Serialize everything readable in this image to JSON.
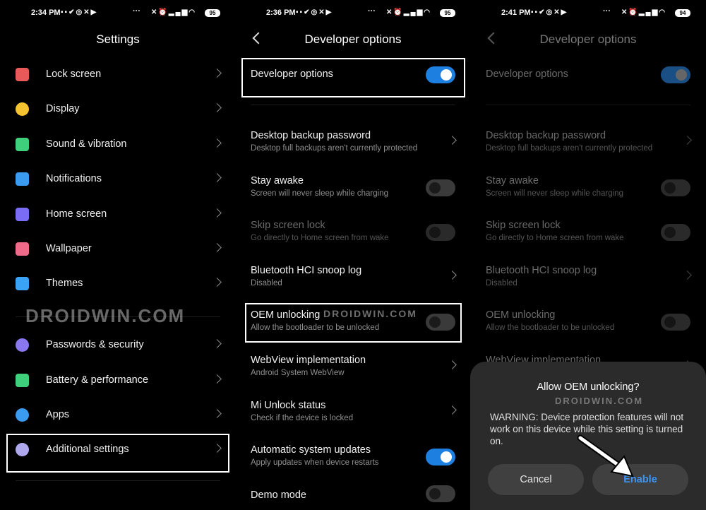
{
  "panel1": {
    "time": "2:34 PM",
    "battery": "95",
    "title": "Settings",
    "items": [
      {
        "label": "Lock screen",
        "icon": "lock-icon",
        "color": "#e85a5a"
      },
      {
        "label": "Display",
        "icon": "sun-icon",
        "color": "#f5c230"
      },
      {
        "label": "Sound & vibration",
        "icon": "speaker-icon",
        "color": "#3ed07a"
      },
      {
        "label": "Notifications",
        "icon": "notification-icon",
        "color": "#3a9bf0"
      },
      {
        "label": "Home screen",
        "icon": "home-icon",
        "color": "#7b6cf5"
      },
      {
        "label": "Wallpaper",
        "icon": "tulip-icon",
        "color": "#f06a8a"
      },
      {
        "label": "Themes",
        "icon": "brush-icon",
        "color": "#3aa3f5"
      },
      {
        "label": "Passwords & security",
        "icon": "fingerprint-icon",
        "color": "#8a78f0"
      },
      {
        "label": "Battery & performance",
        "icon": "battery-icon",
        "color": "#3ed07a"
      },
      {
        "label": "Apps",
        "icon": "gear-icon",
        "color": "#3a9bf0"
      },
      {
        "label": "Additional settings",
        "icon": "more-dots-icon",
        "color": "#b0a8ee"
      }
    ]
  },
  "panel2": {
    "time": "2:36 PM",
    "battery": "95",
    "title": "Developer options",
    "master_label": "Developer options",
    "rows": [
      {
        "title": "Desktop backup password",
        "sub": "Desktop full backups aren't currently protected"
      },
      {
        "title": "Stay awake",
        "sub": "Screen will never sleep while charging"
      },
      {
        "title": "Skip screen lock",
        "sub": "Go directly to Home screen from wake"
      },
      {
        "title": "Bluetooth HCI snoop log",
        "sub": "Disabled"
      },
      {
        "title": "OEM unlocking",
        "sub": "Allow the bootloader to be unlocked"
      },
      {
        "title": "WebView implementation",
        "sub": "Android System WebView"
      },
      {
        "title": "Mi Unlock status",
        "sub": "Check if the device is locked"
      },
      {
        "title": "Automatic system updates",
        "sub": "Apply updates when device restarts"
      },
      {
        "title": "Demo mode",
        "sub": ""
      }
    ]
  },
  "panel3": {
    "time": "2:41 PM",
    "battery": "94",
    "title": "Developer options",
    "master_label": "Developer options",
    "dialog": {
      "title": "Allow OEM unlocking?",
      "message": "WARNING: Device protection features will not work on this device while this setting is turned on.",
      "cancel": "Cancel",
      "enable": "Enable"
    }
  },
  "watermark": "DROIDWIN.COM",
  "colors": {
    "accent": "#1d7fe0",
    "dialog_bg": "#2b2b2b"
  }
}
